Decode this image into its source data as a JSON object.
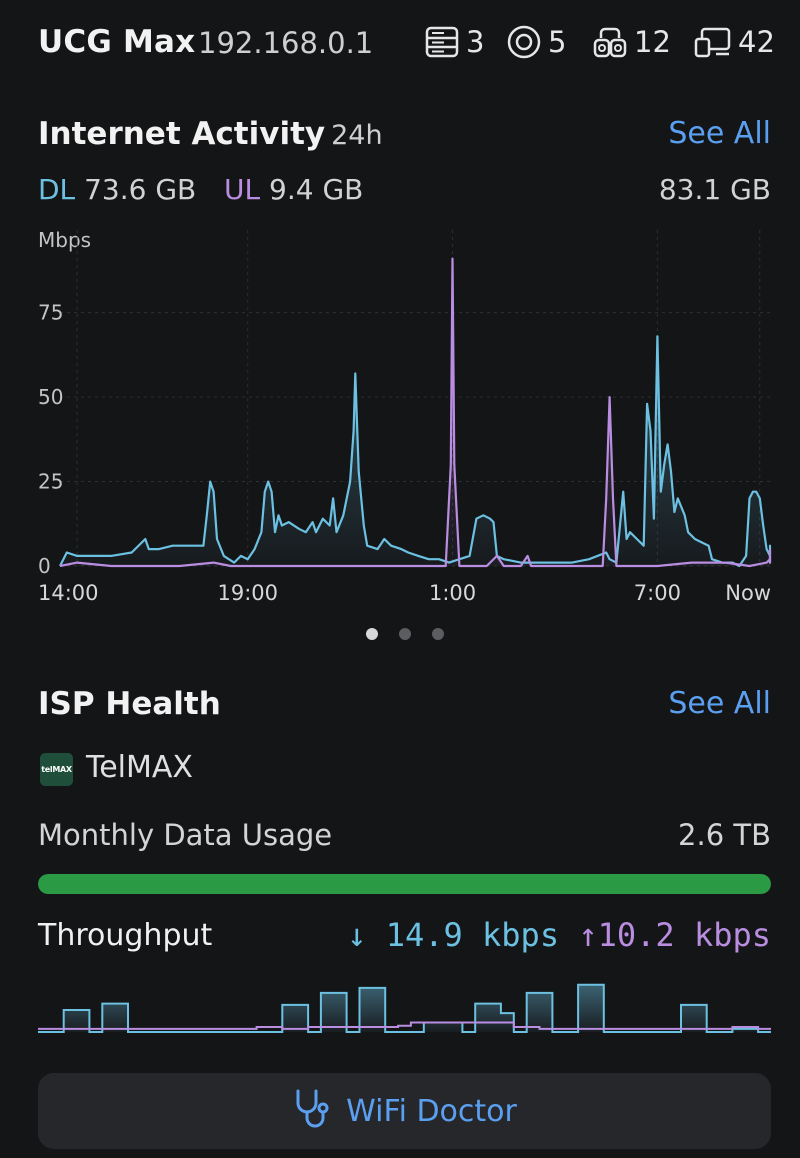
{
  "header": {
    "device_name": "UCG Max",
    "ip": "192.168.0.1",
    "stats": [
      {
        "icon": "network-device-icon",
        "value": "3"
      },
      {
        "icon": "access-point-icon",
        "value": "5"
      },
      {
        "icon": "wired-clients-icon",
        "value": "12"
      },
      {
        "icon": "wireless-clients-icon",
        "value": "42"
      }
    ]
  },
  "internet_activity": {
    "title": "Internet Activity",
    "period": "24h",
    "see_all": "See All",
    "dl_label": "DL",
    "dl_value": "73.6 GB",
    "ul_label": "UL",
    "ul_value": "9.4 GB",
    "total": "83.1 GB",
    "page_indicator": {
      "count": 3,
      "active": 0
    }
  },
  "chart_data": {
    "type": "line",
    "ylabel": "Mbps",
    "yticks": [
      "0",
      "25",
      "50",
      "75"
    ],
    "ylim": [
      0,
      90
    ],
    "xticks": [
      {
        "label": "14:00",
        "hour": 0
      },
      {
        "label": "19:00",
        "hour": 5
      },
      {
        "label": "1:00",
        "hour": 11
      },
      {
        "label": "7:00",
        "hour": 17
      },
      {
        "label": "Now",
        "hour": 20
      }
    ],
    "xlim": [
      -0.5,
      20.3
    ],
    "grid": true,
    "series": [
      {
        "name": "DL",
        "color": "#6cc1e2",
        "points": [
          [
            -0.5,
            0
          ],
          [
            -0.3,
            4
          ],
          [
            0,
            3
          ],
          [
            0.5,
            3
          ],
          [
            1,
            3
          ],
          [
            1.6,
            4
          ],
          [
            2,
            8
          ],
          [
            2.1,
            5
          ],
          [
            2.4,
            5
          ],
          [
            2.8,
            6
          ],
          [
            3.4,
            6
          ],
          [
            3.7,
            6
          ],
          [
            3.8,
            15
          ],
          [
            3.9,
            25
          ],
          [
            4.0,
            22
          ],
          [
            4.1,
            8
          ],
          [
            4.3,
            3
          ],
          [
            4.6,
            1
          ],
          [
            4.8,
            3
          ],
          [
            5.0,
            2
          ],
          [
            5.2,
            5
          ],
          [
            5.4,
            10
          ],
          [
            5.5,
            22
          ],
          [
            5.6,
            25
          ],
          [
            5.7,
            22
          ],
          [
            5.8,
            10
          ],
          [
            5.9,
            15
          ],
          [
            6.0,
            12
          ],
          [
            6.2,
            13
          ],
          [
            6.5,
            11
          ],
          [
            6.7,
            10
          ],
          [
            6.9,
            13
          ],
          [
            7.0,
            10
          ],
          [
            7.2,
            14
          ],
          [
            7.4,
            12
          ],
          [
            7.5,
            20
          ],
          [
            7.6,
            10
          ],
          [
            7.8,
            15
          ],
          [
            8.0,
            25
          ],
          [
            8.1,
            40
          ],
          [
            8.15,
            57
          ],
          [
            8.25,
            28
          ],
          [
            8.4,
            12
          ],
          [
            8.5,
            6
          ],
          [
            8.8,
            5
          ],
          [
            9.0,
            8
          ],
          [
            9.2,
            6
          ],
          [
            9.5,
            5
          ],
          [
            9.7,
            4
          ],
          [
            10.0,
            3
          ],
          [
            10.3,
            2
          ],
          [
            10.6,
            2
          ],
          [
            10.9,
            1
          ],
          [
            11.2,
            2
          ],
          [
            11.5,
            3
          ],
          [
            11.7,
            14
          ],
          [
            11.9,
            15
          ],
          [
            12.1,
            14
          ],
          [
            12.2,
            13
          ],
          [
            12.3,
            3
          ],
          [
            12.5,
            2
          ],
          [
            13.0,
            1
          ],
          [
            13.5,
            1
          ],
          [
            14.0,
            1
          ],
          [
            14.5,
            1
          ],
          [
            15.0,
            2
          ],
          [
            15.5,
            4
          ],
          [
            15.6,
            2
          ],
          [
            15.8,
            1
          ],
          [
            16.0,
            22
          ],
          [
            16.1,
            8
          ],
          [
            16.2,
            10
          ],
          [
            16.4,
            8
          ],
          [
            16.6,
            6
          ],
          [
            16.7,
            48
          ],
          [
            16.8,
            40
          ],
          [
            16.9,
            14
          ],
          [
            17.0,
            68
          ],
          [
            17.1,
            22
          ],
          [
            17.2,
            30
          ],
          [
            17.3,
            36
          ],
          [
            17.4,
            28
          ],
          [
            17.5,
            16
          ],
          [
            17.6,
            20
          ],
          [
            17.8,
            15
          ],
          [
            17.9,
            10
          ],
          [
            18.1,
            8
          ],
          [
            18.3,
            7
          ],
          [
            18.5,
            6
          ],
          [
            18.6,
            2
          ],
          [
            18.9,
            1
          ],
          [
            19.2,
            1
          ],
          [
            19.4,
            0
          ],
          [
            19.6,
            3
          ],
          [
            19.7,
            20
          ],
          [
            19.8,
            22
          ],
          [
            19.9,
            22
          ],
          [
            20.0,
            20
          ],
          [
            20.1,
            12
          ],
          [
            20.2,
            5
          ],
          [
            20.4,
            3
          ],
          [
            20.6,
            5
          ],
          [
            20.8,
            3
          ],
          [
            20.9,
            1
          ],
          [
            21.1,
            5
          ],
          [
            21.3,
            6
          ],
          [
            21.5,
            4
          ],
          [
            21.7,
            2
          ]
        ]
      },
      {
        "name": "UL",
        "color": "#b98de0",
        "points": [
          [
            -0.5,
            0
          ],
          [
            0,
            1
          ],
          [
            1,
            0
          ],
          [
            2,
            0
          ],
          [
            3,
            0
          ],
          [
            4,
            1
          ],
          [
            4.5,
            0
          ],
          [
            5,
            0
          ],
          [
            6,
            0
          ],
          [
            7,
            0
          ],
          [
            8,
            0
          ],
          [
            9,
            0
          ],
          [
            10,
            0
          ],
          [
            10.8,
            0
          ],
          [
            10.95,
            30
          ],
          [
            11.0,
            91
          ],
          [
            11.05,
            30
          ],
          [
            11.2,
            0
          ],
          [
            12,
            0
          ],
          [
            12.3,
            3
          ],
          [
            12.5,
            0
          ],
          [
            13,
            0
          ],
          [
            13.2,
            3
          ],
          [
            13.3,
            0
          ],
          [
            14,
            0
          ],
          [
            15,
            0
          ],
          [
            15.4,
            0
          ],
          [
            15.5,
            20
          ],
          [
            15.6,
            50
          ],
          [
            15.7,
            20
          ],
          [
            15.8,
            0
          ],
          [
            16.5,
            0
          ],
          [
            17,
            0
          ],
          [
            18,
            1
          ],
          [
            19,
            1
          ],
          [
            19.7,
            0
          ],
          [
            20.2,
            1
          ],
          [
            20.4,
            2
          ],
          [
            20.6,
            3
          ],
          [
            21,
            1
          ],
          [
            21.5,
            3
          ],
          [
            21.7,
            5
          ]
        ]
      }
    ]
  },
  "isp_health": {
    "title": "ISP Health",
    "see_all": "See All",
    "logo_text": "telMAX",
    "isp_name": "TelMAX",
    "monthly_label": "Monthly Data Usage",
    "monthly_value": "2.6 TB",
    "monthly_fraction": 1.0,
    "bar_color": "#2b9a45"
  },
  "throughput": {
    "label": "Throughput",
    "down_arrow": "↓",
    "down_value": "14.9 kbps",
    "up_arrow": "↑",
    "up_value": "10.2 kbps",
    "down_levels": [
      0,
      0,
      0.35,
      0.35,
      0,
      0.45,
      0.45,
      0,
      0,
      0,
      0,
      0,
      0,
      0,
      0,
      0,
      0,
      0,
      0,
      0.43,
      0.43,
      0,
      0.62,
      0.62,
      0,
      0.7,
      0.7,
      0,
      0,
      0,
      0.15,
      0.15,
      0.15,
      0,
      0.45,
      0.45,
      0.3,
      0,
      0.62,
      0.62,
      0,
      0,
      0.75,
      0.75,
      0,
      0,
      0,
      0,
      0,
      0,
      0.43,
      0.43,
      0,
      0,
      0.05,
      0.05,
      0
    ],
    "up_levels": [
      0.05,
      0.05,
      0.05,
      0.05,
      0.05,
      0.05,
      0.05,
      0.05,
      0.05,
      0.05,
      0.05,
      0.05,
      0.05,
      0.05,
      0.05,
      0.05,
      0.05,
      0.08,
      0.08,
      0.05,
      0.05,
      0.08,
      0.08,
      0.08,
      0.08,
      0.08,
      0.08,
      0.08,
      0.1,
      0.15,
      0.15,
      0.15,
      0.15,
      0.15,
      0.15,
      0.15,
      0.15,
      0.08,
      0.08,
      0.05,
      0.05,
      0.05,
      0.05,
      0.05,
      0.05,
      0.05,
      0.05,
      0.05,
      0.05,
      0.05,
      0.05,
      0.05,
      0.05,
      0.05,
      0.08,
      0.08,
      0.05
    ]
  },
  "wifi_doctor": {
    "label": "WiFi Doctor",
    "icon": "stethoscope-icon"
  }
}
